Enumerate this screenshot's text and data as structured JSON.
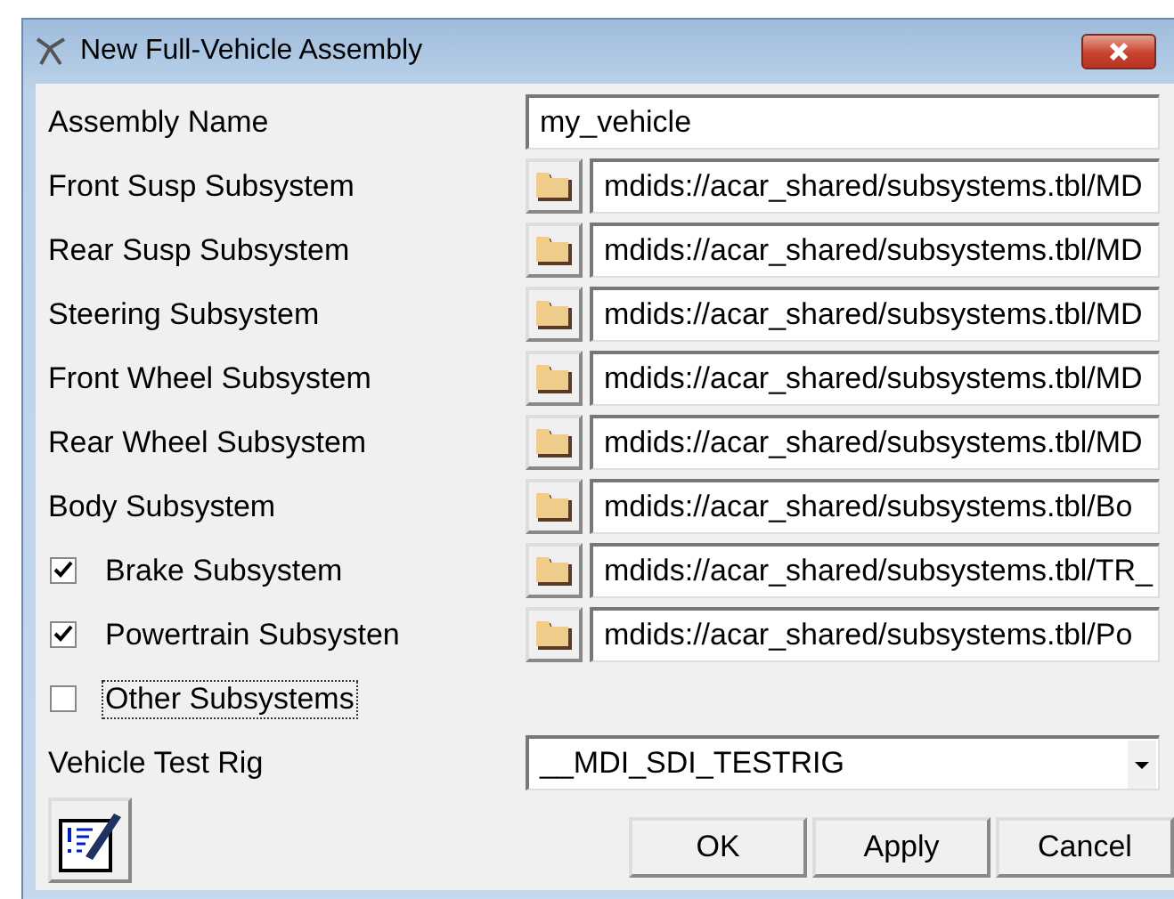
{
  "window": {
    "title": "New Full-Vehicle Assembly"
  },
  "assembly_name": {
    "label": "Assembly Name",
    "value": "my_vehicle"
  },
  "subsystems": [
    {
      "kind": "file",
      "label": "Front Susp Subsystem",
      "value": "mdids://acar_shared/subsystems.tbl/MD"
    },
    {
      "kind": "file",
      "label": "Rear Susp Subsystem",
      "value": "mdids://acar_shared/subsystems.tbl/MD"
    },
    {
      "kind": "file",
      "label": "Steering Subsystem",
      "value": "mdids://acar_shared/subsystems.tbl/MD"
    },
    {
      "kind": "file",
      "label": "Front Wheel Subsystem",
      "value": "mdids://acar_shared/subsystems.tbl/MD"
    },
    {
      "kind": "file",
      "label": "Rear Wheel Subsystem",
      "value": "mdids://acar_shared/subsystems.tbl/MD"
    },
    {
      "kind": "file",
      "label": "Body Subsystem",
      "value": "mdids://acar_shared/subsystems.tbl/Bo"
    },
    {
      "kind": "check_file",
      "label": "Brake Subsystem",
      "checked": true,
      "focused": false,
      "value": "mdids://acar_shared/subsystems.tbl/TR_"
    },
    {
      "kind": "check_file",
      "label": "Powertrain Subsysten",
      "checked": true,
      "focused": false,
      "value": "mdids://acar_shared/subsystems.tbl/Po"
    },
    {
      "kind": "check",
      "label": "Other Subsystems",
      "checked": false,
      "focused": true
    }
  ],
  "test_rig": {
    "label": "Vehicle Test Rig",
    "value": "__MDI_SDI_TESTRIG"
  },
  "buttons": [
    "OK",
    "Apply",
    "Cancel"
  ]
}
